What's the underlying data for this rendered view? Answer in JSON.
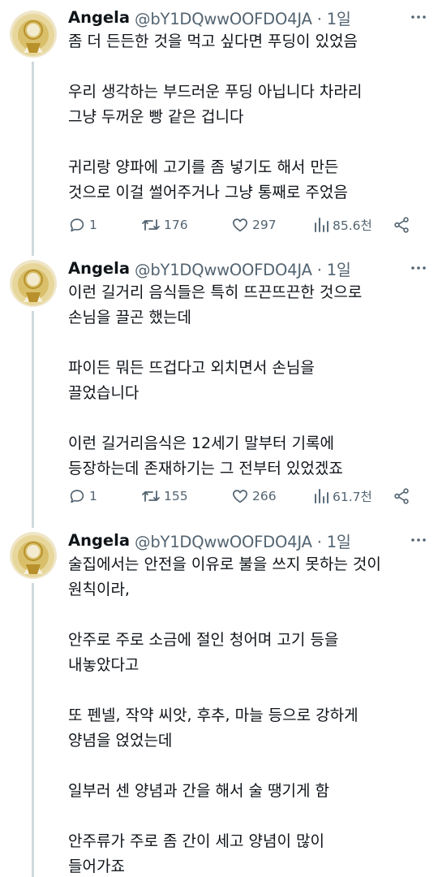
{
  "tweets": [
    {
      "name": "Angela",
      "handle": "@bY1DQwwOOFDO4JA · 1일",
      "paragraphs": [
        "좀 더 든든한 것을 먹고 싶다면 푸딩이 있었음",
        "우리 생각하는 부드러운 푸딩 아닙니다 차라리\n그냥 두꺼운 빵 같은 겁니다",
        "귀리랑 양파에 고기를 좀 넣기도 해서 만든\n것으로 이걸 썰어주거나 그냥 통째로 주었음"
      ],
      "replies": "1",
      "retweets": "176",
      "likes": "297",
      "views": "85.6천"
    },
    {
      "name": "Angela",
      "handle": "@bY1DQwwOOFDO4JA · 1일",
      "paragraphs": [
        "이런 길거리 음식들은 특히 뜨끈뜨끈한 것으로\n손님을 끌곤 했는데",
        "파이든 뭐든 뜨겁다고 외치면서 손님을\n끌었습니다",
        "이런 길거리음식은 12세기 말부터 기록에\n등장하는데 존재하기는 그 전부터 있었겠죠"
      ],
      "replies": "1",
      "retweets": "155",
      "likes": "266",
      "views": "61.7천"
    },
    {
      "name": "Angela",
      "handle": "@bY1DQwwOOFDO4JA · 1일",
      "paragraphs": [
        "술집에서는 안전을 이유로 불을 쓰지 못하는 것이\n원칙이라,",
        "안주로 주로 소금에 절인 청어며 고기 등을\n내놓았다고",
        "또 펜넬, 작약 씨앗, 후추, 마늘 등으로 강하게\n양념을 얹었는데",
        "일부러 센 양념과 간을 해서 술 땡기게 함",
        "안주류가 주로 좀 간이 세고 양념이 많이\n들어가죠"
      ]
    }
  ],
  "icons": {
    "reply": "speech-bubble-icon",
    "retweet": "retweet-arrows-icon",
    "like": "heart-icon",
    "views": "bar-chart-icon",
    "share": "share-icon",
    "more": "more-dots-icon",
    "avatar": "avatar-golden-figure"
  },
  "colors": {
    "text": "#0f1419",
    "secondary": "#536471",
    "thread_line": "#cfd9de",
    "avatar_gold": "#c9a43a"
  }
}
